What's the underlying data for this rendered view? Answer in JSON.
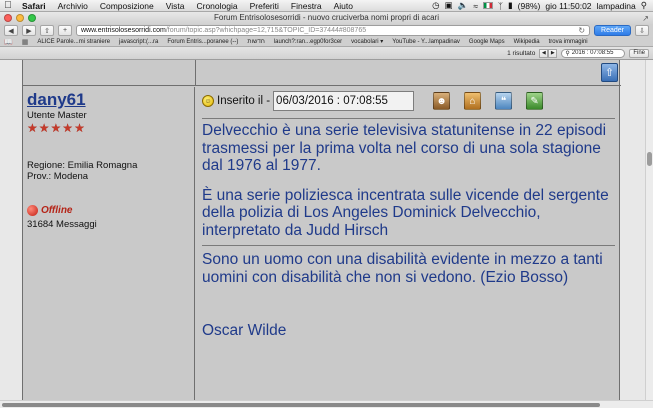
{
  "menubar": {
    "apple": "",
    "items": [
      "Safari",
      "Archivio",
      "Composizione",
      "Vista",
      "Cronologia",
      "Preferiti",
      "Finestra",
      "Aiuto"
    ],
    "battery": "(98%)",
    "clock": "gio 11:50:02",
    "user": "lampadina"
  },
  "window": {
    "title": "Forum Entrisolosesorridi - nuovo cruciverba nomi propri di acari"
  },
  "toolbar": {
    "url_host": "www.entrisolosesorridi.com",
    "url_rest": "/forum/topic.asp?whichpage=12,715&TOPIC_ID=37444#808765",
    "reader_label": "Reader"
  },
  "bookmarks": {
    "items": [
      "ALICE Parole...mi straniere",
      "javascript:(...ra",
      "Forum Entris...poranee (--)",
      "חדשות",
      "launch?:ran...egp0for3cer",
      "vocabolari ▾",
      "YouTube - Y...lampadinav",
      "Google Maps",
      "Wikipedia",
      "trova immagini"
    ]
  },
  "findbar": {
    "result_count": "1 risultato",
    "query": "2016 : 07:08:55",
    "done_label": "Fine"
  },
  "post": {
    "author": {
      "username": "dany61",
      "rank": "Utente Master",
      "star_count": 5,
      "region": "Regione: Emilia Romagna",
      "province": "Prov.: Modena",
      "status": "Offline",
      "messages": "31684 Messaggi"
    },
    "inserted_label": "Inserito il -",
    "datetime": "06/03/2016 : 07:08:55",
    "paragraphs": [
      "Delvecchio è una serie televisiva statunitense in 22 episodi trasmessi per la prima volta nel corso di una sola stagione dal 1976 al 1977.",
      "È una serie poliziesca incentrata sulle vicende del sergente della polizia di Los Angeles Dominick Delvecchio, interpretato da Judd Hirsch"
    ],
    "signature": "Sono un uomo con una disabilità evidente in mezzo a tanti uomini con disabilità che non si vedono. (Ezio Bosso)",
    "signature_extra": "Oscar Wilde"
  },
  "colors": {
    "post_text": "#1f3a8a",
    "table_bg": "#c9c9c9",
    "offline_red": "#b52417"
  }
}
